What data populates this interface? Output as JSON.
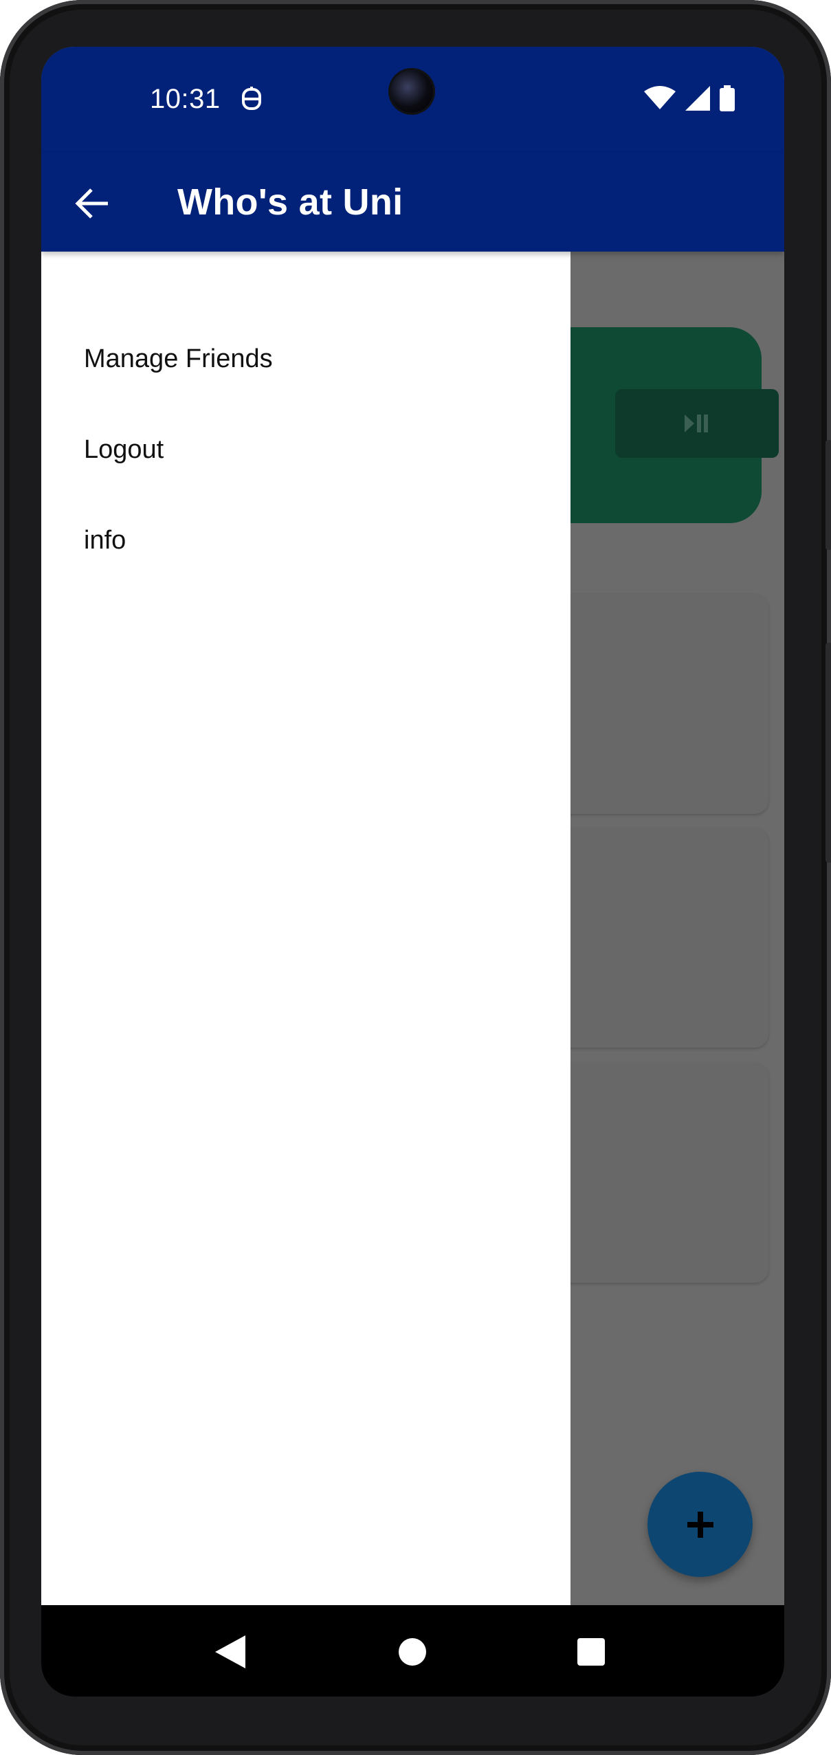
{
  "status_bar": {
    "time": "10:31",
    "background_color": "#022178",
    "icons": [
      "alert-icon",
      "wifi-icon",
      "signal-icon",
      "battery-icon"
    ]
  },
  "app_bar": {
    "title": "Who's at Uni",
    "back_icon": "arrow-back-icon",
    "background_color": "#022178"
  },
  "drawer": {
    "items": [
      {
        "label": "Manage Friends"
      },
      {
        "label": "Logout"
      },
      {
        "label": "info"
      }
    ]
  },
  "background": {
    "player_card_color": "#0f4a35",
    "player_button_icon": "play-pause-icon",
    "fab_icon": "plus-icon",
    "fab_color": "#0d4670"
  },
  "nav_bar": {
    "buttons": [
      "back-triangle-icon",
      "home-circle-icon",
      "recents-square-icon"
    ]
  }
}
